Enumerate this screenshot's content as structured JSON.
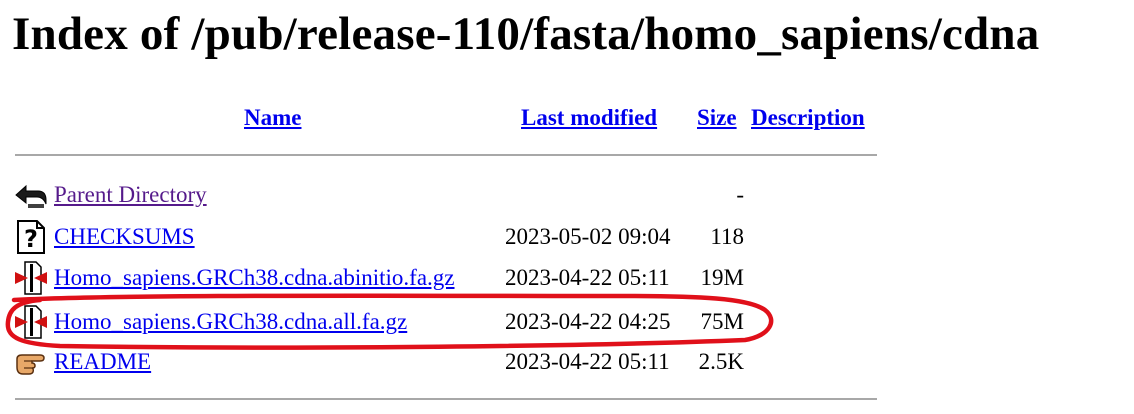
{
  "page": {
    "title": "Index of /pub/release-110/fasta/homo_sapiens/cdna"
  },
  "columns": {
    "name": "Name",
    "last_modified": "Last modified",
    "size": "Size",
    "description": "Description"
  },
  "rows": [
    {
      "icon": "back-arrow-icon",
      "name": "Parent Directory",
      "modified": "",
      "size": "-",
      "visited": true
    },
    {
      "icon": "unknown-file-icon",
      "name": "CHECKSUMS",
      "modified": "2023-05-02 09:04",
      "size": "118"
    },
    {
      "icon": "compressed-file-icon",
      "name": "Homo_sapiens.GRCh38.cdna.abinitio.fa.gz",
      "modified": "2023-04-22 05:11",
      "size": "19M"
    },
    {
      "icon": "compressed-file-icon",
      "name": "Homo_sapiens.GRCh38.cdna.all.fa.gz",
      "modified": "2023-04-22 04:25",
      "size": "75M",
      "highlighted": true
    },
    {
      "icon": "hand-pointing-icon",
      "name": "README",
      "modified": "2023-04-22 05:11",
      "size": "2.5K"
    }
  ],
  "colors": {
    "link": "#0000ee",
    "visited_link": "#551a8b",
    "rule": "#a8a8a8",
    "annotation": "#e0101a"
  }
}
